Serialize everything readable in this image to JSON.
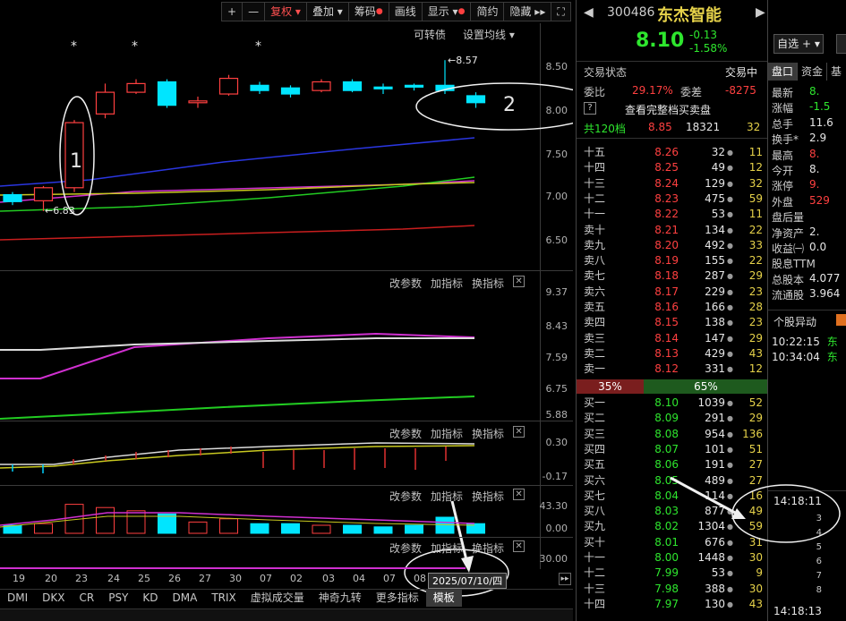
{
  "toolbar": {
    "plus": "+",
    "minus": "—",
    "fuquan": "复权",
    "diejia": "叠加",
    "chouma": "筹码",
    "huaxian": "画线",
    "xianshi": "显示",
    "jianyue": "简约",
    "yincang": "隐藏",
    "kezhuanzhai": "可转债",
    "shezhi_junxian": "设置均线"
  },
  "main_axis": [
    "8.50",
    "8.00",
    "7.50",
    "7.00",
    "6.50"
  ],
  "annotations": {
    "high_price": "8.57",
    "low_price": "6.83",
    "circle1": "1",
    "circle2": "2",
    "star": "*"
  },
  "panel_tools": {
    "gaicanshu": "改参数",
    "jiazhibiao": "加指标",
    "huanzhibiao": "换指标",
    "close": "✕"
  },
  "panel2_axis": [
    "9.37",
    "8.43",
    "7.59",
    "6.75",
    "5.88"
  ],
  "panel3_axis": [
    "0.30",
    "-0.17"
  ],
  "panel4_axis": [
    "43.30",
    "0.00"
  ],
  "panel5_axis": [
    "30.00"
  ],
  "dates": [
    "19",
    "20",
    "23",
    "24",
    "25",
    "26",
    "27",
    "30",
    "07",
    "02",
    "03",
    "04",
    "07",
    "08"
  ],
  "date_tooltip": "2025/07/10/四",
  "indicator_tabs": [
    "DMI",
    "DKX",
    "CR",
    "PSY",
    "KD",
    "DMA",
    "TRIX",
    "虚拟成交量",
    "神奇九转",
    "更多指标",
    "模板"
  ],
  "stock": {
    "code": "300486",
    "name": "东杰智能",
    "price": "8.10",
    "change": "-0.13",
    "change_pct": "-1.58%",
    "zixuan": "自选",
    "trade_status_label": "交易状态",
    "trade_status": "交易中",
    "weibi_label": "委比",
    "weibi": "29.17%",
    "weicha_label": "委差",
    "weicha": "-8275",
    "help": "?",
    "view_full": "查看完整档买卖盘",
    "total_label": "共120档",
    "total_price": "8.85",
    "total_vol": "18321",
    "total_cnt": "32"
  },
  "sell_levels": [
    {
      "name": "十五",
      "price": "8.26",
      "vol": "32",
      "cnt": "11"
    },
    {
      "name": "十四",
      "price": "8.25",
      "vol": "49",
      "cnt": "12"
    },
    {
      "name": "十三",
      "price": "8.24",
      "vol": "129",
      "cnt": "32"
    },
    {
      "name": "十二",
      "price": "8.23",
      "vol": "475",
      "cnt": "59"
    },
    {
      "name": "十一",
      "price": "8.22",
      "vol": "53",
      "cnt": "11"
    },
    {
      "name": "卖十",
      "price": "8.21",
      "vol": "134",
      "cnt": "22"
    },
    {
      "name": "卖九",
      "price": "8.20",
      "vol": "492",
      "cnt": "33"
    },
    {
      "name": "卖八",
      "price": "8.19",
      "vol": "155",
      "cnt": "22"
    },
    {
      "name": "卖七",
      "price": "8.18",
      "vol": "287",
      "cnt": "29"
    },
    {
      "name": "卖六",
      "price": "8.17",
      "vol": "229",
      "cnt": "23"
    },
    {
      "name": "卖五",
      "price": "8.16",
      "vol": "166",
      "cnt": "28"
    },
    {
      "name": "卖四",
      "price": "8.15",
      "vol": "138",
      "cnt": "23"
    },
    {
      "name": "卖三",
      "price": "8.14",
      "vol": "147",
      "cnt": "29"
    },
    {
      "name": "卖二",
      "price": "8.13",
      "vol": "429",
      "cnt": "43"
    },
    {
      "name": "卖一",
      "price": "8.12",
      "vol": "331",
      "cnt": "12"
    }
  ],
  "ratio": {
    "sell": "35%",
    "buy": "65%"
  },
  "buy_levels": [
    {
      "name": "买一",
      "price": "8.10",
      "vol": "1039",
      "cnt": "52"
    },
    {
      "name": "买二",
      "price": "8.09",
      "vol": "291",
      "cnt": "29"
    },
    {
      "name": "买三",
      "price": "8.08",
      "vol": "954",
      "cnt": "136"
    },
    {
      "name": "买四",
      "price": "8.07",
      "vol": "101",
      "cnt": "51"
    },
    {
      "name": "买五",
      "price": "8.06",
      "vol": "191",
      "cnt": "27"
    },
    {
      "name": "买六",
      "price": "8.05",
      "vol": "489",
      "cnt": "27"
    },
    {
      "name": "买七",
      "price": "8.04",
      "vol": "114",
      "cnt": "16"
    },
    {
      "name": "买八",
      "price": "8.03",
      "vol": "877",
      "cnt": "49"
    },
    {
      "name": "买九",
      "price": "8.02",
      "vol": "1304",
      "cnt": "59"
    },
    {
      "name": "买十",
      "price": "8.01",
      "vol": "676",
      "cnt": "31"
    },
    {
      "name": "十一",
      "price": "8.00",
      "vol": "1448",
      "cnt": "30"
    },
    {
      "name": "十二",
      "price": "7.99",
      "vol": "53",
      "cnt": "9"
    },
    {
      "name": "十三",
      "price": "7.98",
      "vol": "388",
      "cnt": "30"
    },
    {
      "name": "十四",
      "price": "7.97",
      "vol": "130",
      "cnt": "43"
    }
  ],
  "right_tabs": [
    "盘口",
    "资金",
    "基"
  ],
  "stats": [
    {
      "k": "最新",
      "v": "8."
    },
    {
      "k": "涨幅",
      "v": "-1.5"
    },
    {
      "k": "总手",
      "v": "11.6"
    },
    {
      "k": "换手*",
      "v": "2.9"
    },
    {
      "k": "最高",
      "v": "8."
    },
    {
      "k": "今开",
      "v": "8."
    },
    {
      "k": "涨停",
      "v": "9."
    },
    {
      "k": "外盘",
      "v": "529"
    },
    {
      "k": "盘后量",
      "v": ""
    },
    {
      "k": "净资产",
      "v": "2."
    },
    {
      "k": "收益㈠",
      "v": "0.0"
    },
    {
      "k": "股息TTM",
      "v": ""
    },
    {
      "k": "总股本",
      "v": "4.077"
    },
    {
      "k": "流通股",
      "v": "3.964"
    }
  ],
  "movement": {
    "title": "个股异动",
    "items": [
      {
        "time": "10:22:15",
        "text": "东"
      },
      {
        "time": "10:34:04",
        "text": "东"
      }
    ]
  },
  "ticks": {
    "time1": "14:18:11",
    "vals": [
      "3",
      "4",
      "5",
      "6",
      "7",
      "8"
    ],
    "time2": "14:18:13"
  },
  "colors": {
    "up": "#ff4040",
    "down": "#2ee62e",
    "cyan": "#00e5ff",
    "ma5": "#e6e6e6",
    "ma_blue": "#2a36e0",
    "ma_red": "#c81e1e"
  }
}
